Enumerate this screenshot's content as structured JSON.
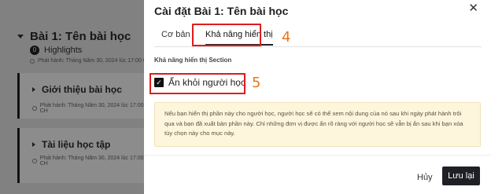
{
  "background": {
    "section_title": "Bài 1: Tên bài học",
    "highlights_badge": "0",
    "highlights_label": "Highlights",
    "meta_1": "Phát hành: Tháng Năm 30, 2024 lúc 17:00 CH",
    "subsection_1_title": "Giới thiệu bài học",
    "meta_2": "Phát hành: Tháng Năm 30, 2024 lúc 17:00 CH",
    "subsection_2_title": "Tài liệu học tập",
    "meta_3": "Phát hành: Tháng Năm 30, 2024 lúc 17:00 CH"
  },
  "modal": {
    "title": "Cài đặt Bài 1: Tên bài học",
    "close_symbol": "✕",
    "tabs": [
      {
        "label": "Cơ bản",
        "active": false
      },
      {
        "label": "Khả năng hiển thị",
        "active": true
      }
    ],
    "section_label": "Khả năng hiển thị Section",
    "checkbox": {
      "label": "Ẩn khỏi người học",
      "checked": true,
      "check_symbol": "✓"
    },
    "info_text": "Nếu bạn hiển thị phần này cho người học, người học sẽ có thể xem nội dung của nó sau khi ngày phát hành trôi qua và bạn đã xuất bản phần này. Chỉ những đơn vị được ẩn rõ ràng với người học sẽ vẫn bị ẩn sau khi bạn xóa tùy chọn này cho mục này.",
    "cancel_label": "Hủy",
    "save_label": "Lưu lại"
  },
  "annotations": {
    "step_tab": "4",
    "step_checkbox": "5",
    "highlight_color": "#e01b1b",
    "number_color": "#e8761a"
  }
}
